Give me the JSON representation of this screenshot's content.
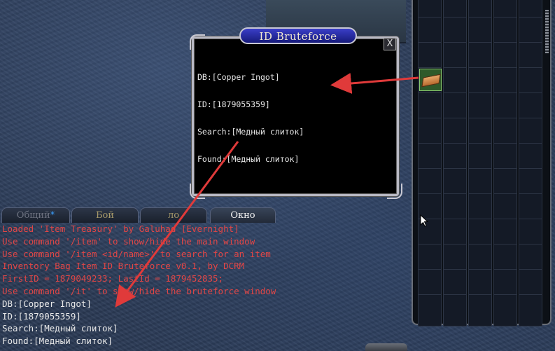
{
  "bruteforce_window": {
    "title": "ID Bruteforce",
    "close_label": "X",
    "lines": [
      "DB:[Copper Ingot]",
      "ID:[1879055359]",
      "Search:[Медный слиток]",
      "Found:[Медный слиток]"
    ]
  },
  "chat": {
    "tabs": {
      "general": "Общий",
      "general_marker": "*",
      "combat": "Бой",
      "lo": "ло",
      "window": "Окно"
    },
    "lines": [
      {
        "text": "Loaded 'Item Treasury' by Galuhad [Evernight]",
        "type": "system"
      },
      {
        "text": "Use command '/item' to show/hide the main window",
        "type": "system"
      },
      {
        "text": "Use command '/item <id/name>' to search for an item",
        "type": "system"
      },
      {
        "text": "Inventory Bag Item ID Bruteforce v0.1, by DCRM",
        "type": "system"
      },
      {
        "text": "FirstID = 1879049233; LastId = 1879452835;",
        "type": "system"
      },
      {
        "text": "Use command '/it' to show/hide the bruteforce window",
        "type": "system"
      },
      {
        "text": "DB:[Copper Ingot]",
        "type": "normal"
      },
      {
        "text": "ID:[1879055359]",
        "type": "normal"
      },
      {
        "text": "Search:[Медный слиток]",
        "type": "normal"
      },
      {
        "text": "Found:[Медный слиток]",
        "type": "normal"
      }
    ]
  },
  "inventory": {
    "columns": 5,
    "rows": 13,
    "item": {
      "name": "copper-ingot",
      "icon": "ingot-icon"
    }
  },
  "colors": {
    "system_text": "#e24646",
    "normal_text": "#e8e8e8",
    "arrow": "#e03a3a",
    "title_bar": "#2a2ea8"
  }
}
